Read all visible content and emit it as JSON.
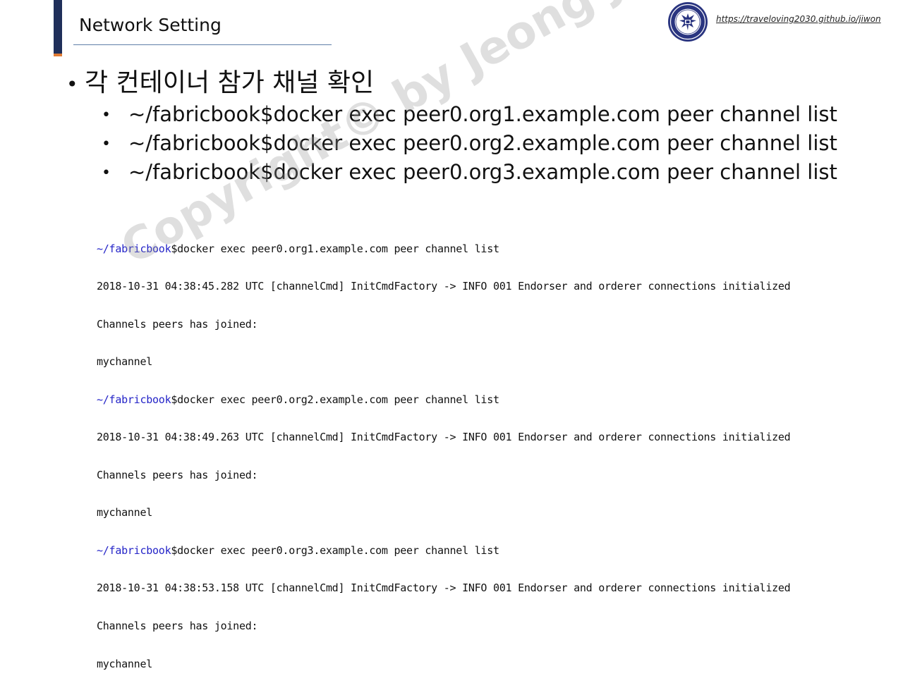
{
  "slide": {
    "title": "Network Setting",
    "url": "https://traveloving2030.github.io/jiwon",
    "main_bullet": "각 컨테이너 참가 채널 확인",
    "commands": [
      "~/fabricbook$docker exec peer0.org1.example.com peer channel list",
      "~/fabricbook$docker exec peer0.org2.example.com peer channel list",
      "~/fabricbook$docker exec peer0.org3.example.com peer channel list"
    ]
  },
  "terminal": {
    "prompt_path": "~/fabricbook",
    "lines": [
      {
        "path": "~/fabricbook",
        "text": "$docker exec peer0.org1.example.com peer channel list"
      },
      {
        "path": "",
        "text": "2018-10-31 04:38:45.282 UTC [channelCmd] InitCmdFactory -> INFO 001 Endorser and orderer connections initialized"
      },
      {
        "path": "",
        "text": "Channels peers has joined:"
      },
      {
        "path": "",
        "text": "mychannel"
      },
      {
        "path": "~/fabricbook",
        "text": "$docker exec peer0.org2.example.com peer channel list"
      },
      {
        "path": "",
        "text": "2018-10-31 04:38:49.263 UTC [channelCmd] InitCmdFactory -> INFO 001 Endorser and orderer connections initialized"
      },
      {
        "path": "",
        "text": "Channels peers has joined:"
      },
      {
        "path": "",
        "text": "mychannel"
      },
      {
        "path": "~/fabricbook",
        "text": "$docker exec peer0.org3.example.com peer channel list"
      },
      {
        "path": "",
        "text": "2018-10-31 04:38:53.158 UTC [channelCmd] InitCmdFactory -> INFO 001 Endorser and orderer connections initialized"
      },
      {
        "path": "",
        "text": "Channels peers has joined:"
      },
      {
        "path": "",
        "text": "mychannel"
      }
    ]
  },
  "watermark": "Copyright© by Jeong Jiwon",
  "colors": {
    "accent_navy": "#1f2f5a",
    "accent_orange": "#e07b33",
    "prompt_blue": "#2424c8",
    "rule_blue": "#5f7fa8"
  },
  "icons": {
    "seal": "university-seal-icon"
  }
}
